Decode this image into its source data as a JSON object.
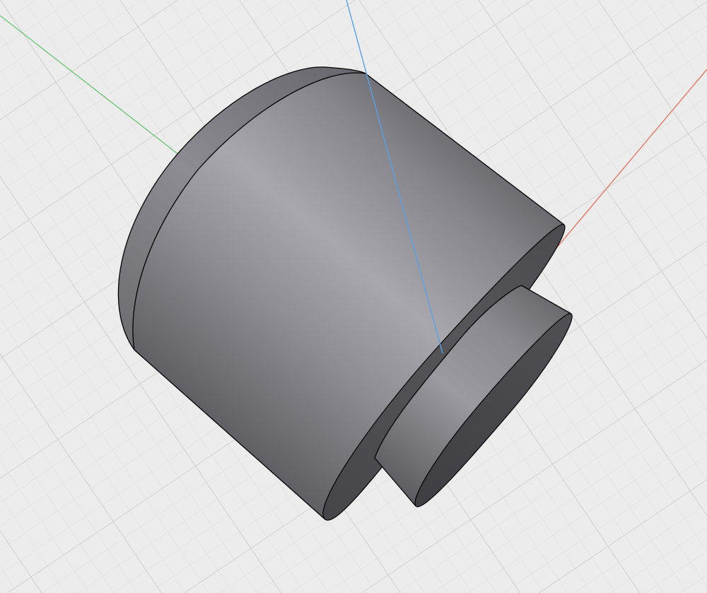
{
  "viewport": {
    "background": "#ececec",
    "grid_minor_color": "#dcdcdc",
    "grid_major_color": "#cfcfcf",
    "grid_visible": true
  },
  "axes": {
    "x_axis_color": "#e07a66",
    "y_axis_color": "#72c47c",
    "z_axis_color": "#5aa0e8"
  },
  "model": {
    "shape": "stepped-cylinder",
    "body_color": "#8d8d93",
    "highlight_color": "#a5a5ab",
    "shadow_color": "#4d4d52",
    "edge_color": "#000000"
  }
}
